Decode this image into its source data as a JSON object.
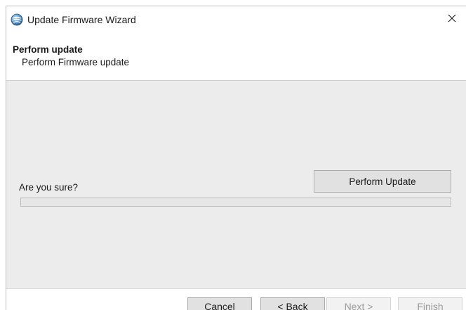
{
  "window": {
    "title": "Update Firmware Wizard",
    "icon": "firmware-wizard-app-icon",
    "close_icon": "close-icon"
  },
  "header": {
    "title": "Perform update",
    "subtitle": "Perform Firmware update"
  },
  "content": {
    "prompt": "Are you sure?",
    "perform_button_label": "Perform Update",
    "progress_percent": 0
  },
  "footer": {
    "cancel_label": "Cancel",
    "back_label": "< Back",
    "next_label": "Next >",
    "finish_label": "Finish",
    "next_enabled": false,
    "finish_enabled": false
  },
  "colors": {
    "content_background": "#ececec",
    "button_background": "#e1e1e1",
    "disabled_text": "#9a9a9a"
  }
}
